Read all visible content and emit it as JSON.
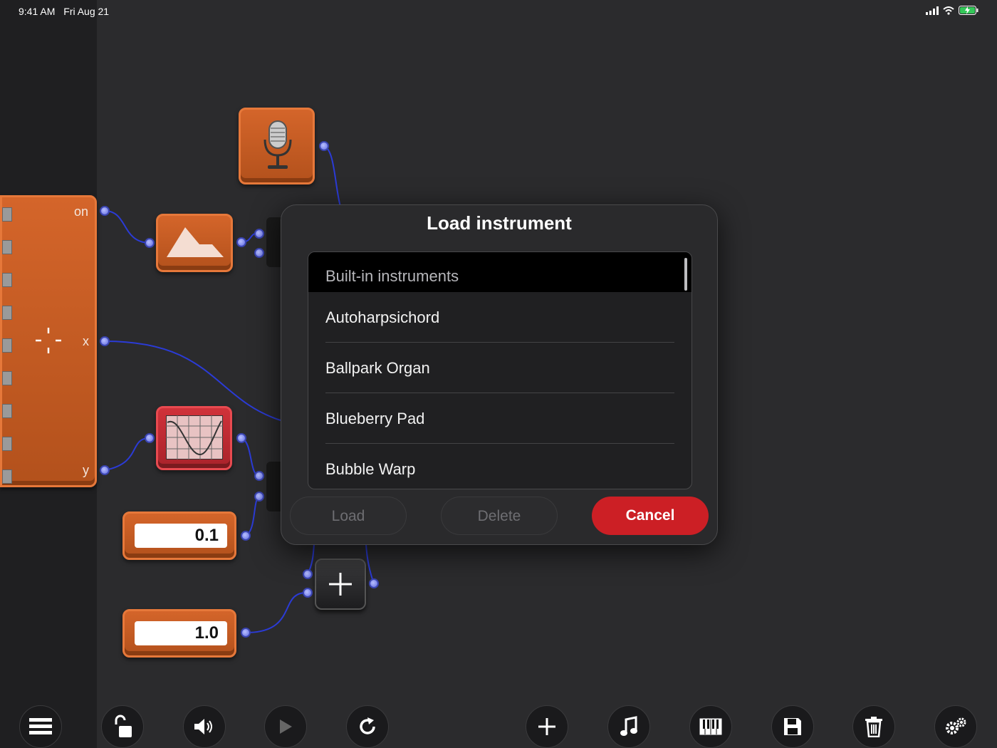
{
  "status_bar": {
    "time": "9:41 AM",
    "date": "Fri Aug 21",
    "icons": [
      "signal-icon",
      "wifi-icon",
      "battery-charging-icon"
    ]
  },
  "canvas": {
    "xy_pad": {
      "labels": {
        "on": "on",
        "x": "x",
        "y": "y"
      },
      "icon": "crosshair-icon"
    },
    "modules": [
      {
        "name": "microphone",
        "icon": "microphone-icon"
      },
      {
        "name": "envelope",
        "icon": "envelope-icon"
      },
      {
        "name": "oscillator",
        "icon": "oscilloscope-icon"
      },
      {
        "name": "adder",
        "icon": "plus-icon"
      }
    ],
    "number_boxes": [
      {
        "value": "0.1"
      },
      {
        "value": "1.0"
      }
    ]
  },
  "dialog": {
    "title": "Load instrument",
    "section_header": "Built-in instruments",
    "items": [
      "Autoharpsichord",
      "Ballpark Organ",
      "Blueberry Pad",
      "Bubble Warp"
    ],
    "buttons": {
      "load": "Load",
      "delete": "Delete",
      "cancel": "Cancel"
    },
    "colors": {
      "cancel": "#cc1f25",
      "background": "#2a2a2c"
    }
  },
  "toolbar": {
    "left": [
      "menu-icon",
      "unlock-icon",
      "speaker-icon",
      "play-icon",
      "refresh-icon"
    ],
    "right": [
      "add-icon",
      "music-note-icon",
      "keyboard-icon",
      "save-icon",
      "trash-icon",
      "settings-icon"
    ]
  },
  "colors": {
    "module_orange": "#c85b22",
    "wire": "#2b3bd6",
    "canvas": "#2b2b2d"
  }
}
